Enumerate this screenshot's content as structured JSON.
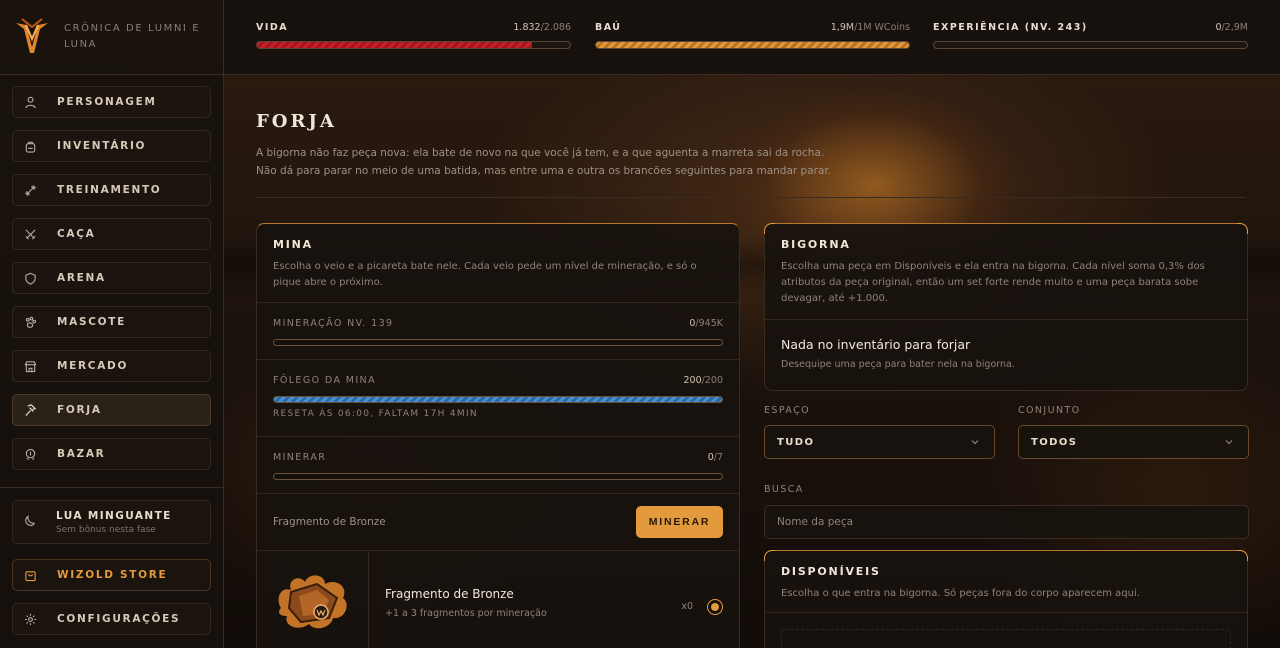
{
  "brand": {
    "name": "Crônica de Lumni e Luna"
  },
  "sidebar": {
    "items": [
      {
        "label": "Personagem",
        "icon": "person-icon"
      },
      {
        "label": "Inventário",
        "icon": "backpack-icon"
      },
      {
        "label": "Treinamento",
        "icon": "dumbbell-icon"
      },
      {
        "label": "Caça",
        "icon": "crossed-swords-icon"
      },
      {
        "label": "Arena",
        "icon": "shield-icon"
      },
      {
        "label": "Mascote",
        "icon": "paw-icon"
      },
      {
        "label": "Mercado",
        "icon": "store-icon"
      },
      {
        "label": "Forja",
        "icon": "hammer-icon"
      },
      {
        "label": "Bazar",
        "icon": "coins-icon"
      }
    ],
    "moon": {
      "title": "LUA MINGUANTE",
      "subtitle": "Sem bônus nesta fase"
    },
    "store_label": "WIZOLD STORE",
    "settings_label": "CONFIGURAÇÕES"
  },
  "topbar": {
    "life": {
      "label": "VIDA",
      "value": "1.832",
      "max": "/2.086",
      "fraction": 0.878
    },
    "chest": {
      "label": "BAÚ",
      "value": "1,9M",
      "max": "/1M WCoins",
      "fraction": 1.0
    },
    "xp": {
      "label": "EXPERIÊNCIA (NV. 243)",
      "value": "0",
      "max": "/2,9M",
      "fraction": 0.0
    }
  },
  "page": {
    "title": "FORJA",
    "desc1": "A bigorna não faz peça nova: ela bate de novo na que você já tem, e a que aguenta a marreta sai da rocha.",
    "desc2": "Não dá para parar no meio de uma batida, mas entre uma e outra os brancões seguintes para mandar parar."
  },
  "mina": {
    "title": "MINA",
    "desc": "Escolha o veio e a picareta bate nele. Cada veio pede um nível de mineração, e só o pique abre o próximo.",
    "mining": {
      "label": "MINERAÇÃO NV. 139",
      "value": "0",
      "max": "/945K",
      "fraction": 0.0
    },
    "breath": {
      "label": "FÔLEGO DA MINA",
      "value": "200",
      "max": "/200",
      "fraction": 1.0,
      "reset": "RESETA ÀS 06:00, FALTAM 17H 4MIN"
    },
    "mine": {
      "label": "MINERAR",
      "value": "0",
      "max": "/7",
      "fraction": 0.0
    },
    "selected_ore": "Fragmento de Bronze",
    "mine_button": "MINERAR",
    "ore": {
      "name": "Fragmento de Bronze",
      "desc": "+1 a 3 fragmentos por mineração",
      "count": "x0"
    }
  },
  "bigorna": {
    "title": "BIGORNA",
    "desc": "Escolha uma peça em Disponíveis e ela entra na bigorna. Cada nível soma 0,3% dos atributos da peça original, então um set forte rende muito e uma peça barata sobe devagar, até +1.000.",
    "empty_title": "Nada no inventário para forjar",
    "empty_desc": "Desequipe uma peça para bater nela na bigorna."
  },
  "filters": {
    "space_label": "ESPAÇO",
    "space_value": "TUDO",
    "set_label": "CONJUNTO",
    "set_value": "TODOS",
    "search_label": "BUSCA",
    "search_placeholder": "Nome da peça"
  },
  "disponiveis": {
    "title": "DISPONÍVEIS",
    "desc": "Escolha o que entra na bigorna. Só peças fora do corpo aparecem aqui."
  },
  "colors": {
    "accent": "#e39a3c",
    "life": "#c81f2c",
    "breath": "#4a8fd0"
  }
}
